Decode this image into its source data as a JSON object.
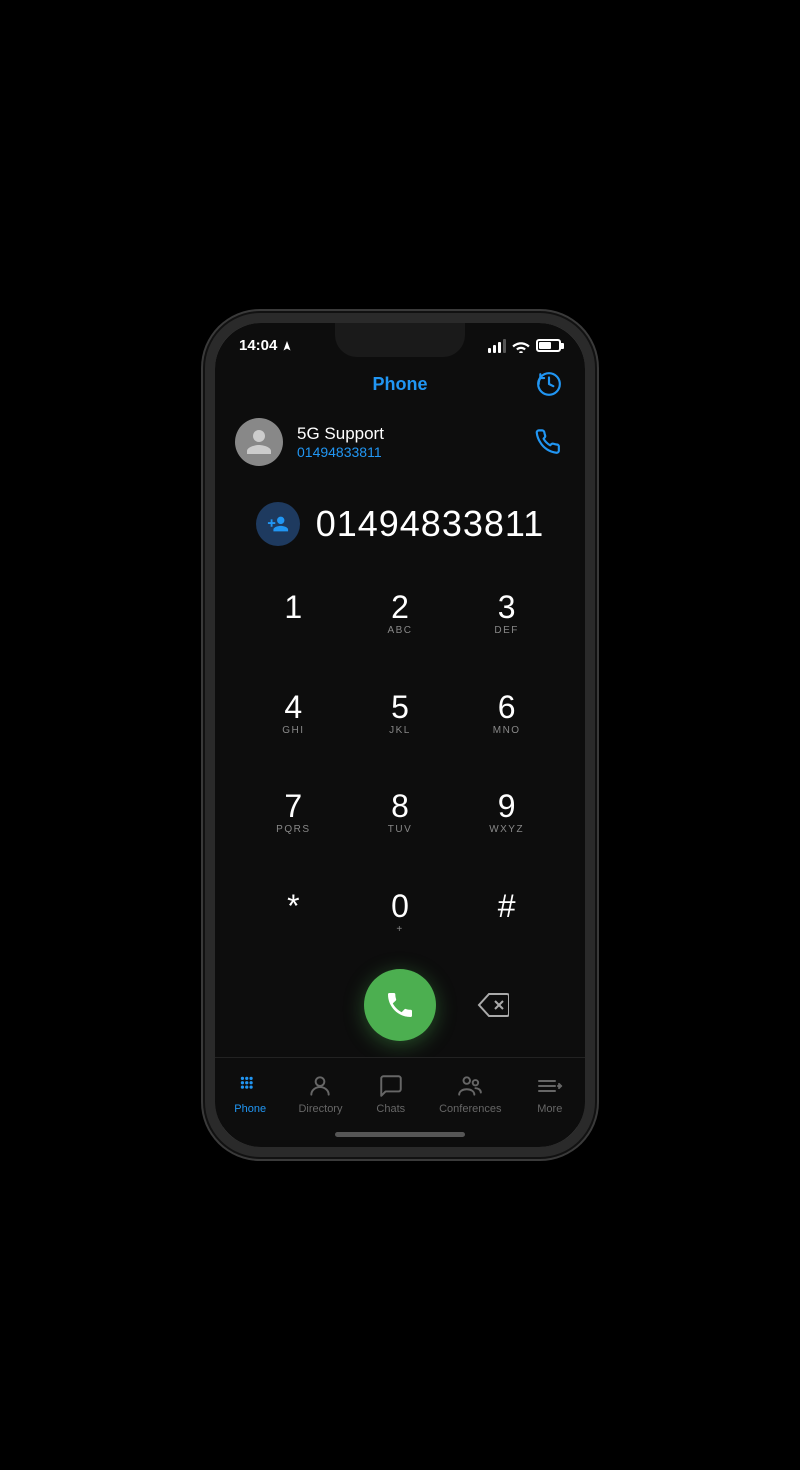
{
  "status_bar": {
    "time": "14:04",
    "location_icon": "→",
    "battery_level": 65
  },
  "header": {
    "title": "Phone",
    "history_tooltip": "Call history"
  },
  "contact": {
    "name": "5G Support",
    "number": "01494833811"
  },
  "dialpad": {
    "displayed_number": "01494833811",
    "keys": [
      {
        "digit": "1",
        "letters": ""
      },
      {
        "digit": "2",
        "letters": "ABC"
      },
      {
        "digit": "3",
        "letters": "DEF"
      },
      {
        "digit": "4",
        "letters": "GHI"
      },
      {
        "digit": "5",
        "letters": "JKL"
      },
      {
        "digit": "6",
        "letters": "MNO"
      },
      {
        "digit": "7",
        "letters": "PQRS"
      },
      {
        "digit": "8",
        "letters": "TUV"
      },
      {
        "digit": "9",
        "letters": "WXYZ"
      },
      {
        "digit": "*",
        "letters": ""
      },
      {
        "digit": "0",
        "letters": "+"
      },
      {
        "digit": "#",
        "letters": ""
      }
    ]
  },
  "bottom_nav": {
    "items": [
      {
        "id": "phone",
        "label": "Phone",
        "active": true
      },
      {
        "id": "directory",
        "label": "Directory",
        "active": false
      },
      {
        "id": "chats",
        "label": "Chats",
        "active": false
      },
      {
        "id": "conferences",
        "label": "Conferences",
        "active": false
      },
      {
        "id": "more",
        "label": "More",
        "active": false
      }
    ]
  },
  "colors": {
    "accent": "#2196f3",
    "call_green": "#4caf50",
    "text_primary": "#ffffff",
    "text_secondary": "#888888",
    "bg_dark": "#0d0d0d"
  }
}
